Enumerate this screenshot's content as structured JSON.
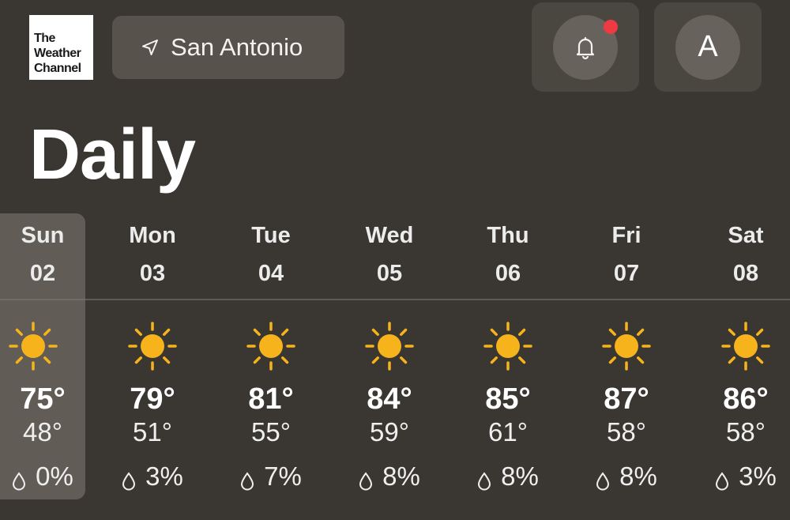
{
  "header": {
    "logo_lines": [
      "The",
      "Weather",
      "Channel"
    ],
    "location": "San Antonio",
    "account_initial": "A"
  },
  "page_title": "Daily",
  "colors": {
    "background": "#3a3631",
    "sun": "#f6b31c",
    "notification_dot": "#ee3a43"
  },
  "days": [
    {
      "name": "Sun",
      "num": "02",
      "high": "75°",
      "low": "48°",
      "precip": "0%",
      "icon": "sun-icon",
      "selected": true
    },
    {
      "name": "Mon",
      "num": "03",
      "high": "79°",
      "low": "51°",
      "precip": "3%",
      "icon": "sun-icon"
    },
    {
      "name": "Tue",
      "num": "04",
      "high": "81°",
      "low": "55°",
      "precip": "7%",
      "icon": "sun-icon"
    },
    {
      "name": "Wed",
      "num": "05",
      "high": "84°",
      "low": "59°",
      "precip": "8%",
      "icon": "sun-icon"
    },
    {
      "name": "Thu",
      "num": "06",
      "high": "85°",
      "low": "61°",
      "precip": "8%",
      "icon": "sun-icon"
    },
    {
      "name": "Fri",
      "num": "07",
      "high": "87°",
      "low": "58°",
      "precip": "8%",
      "icon": "sun-icon"
    },
    {
      "name": "Sat",
      "num": "08",
      "high": "86°",
      "low": "58°",
      "precip": "3%",
      "icon": "sun-icon"
    }
  ]
}
